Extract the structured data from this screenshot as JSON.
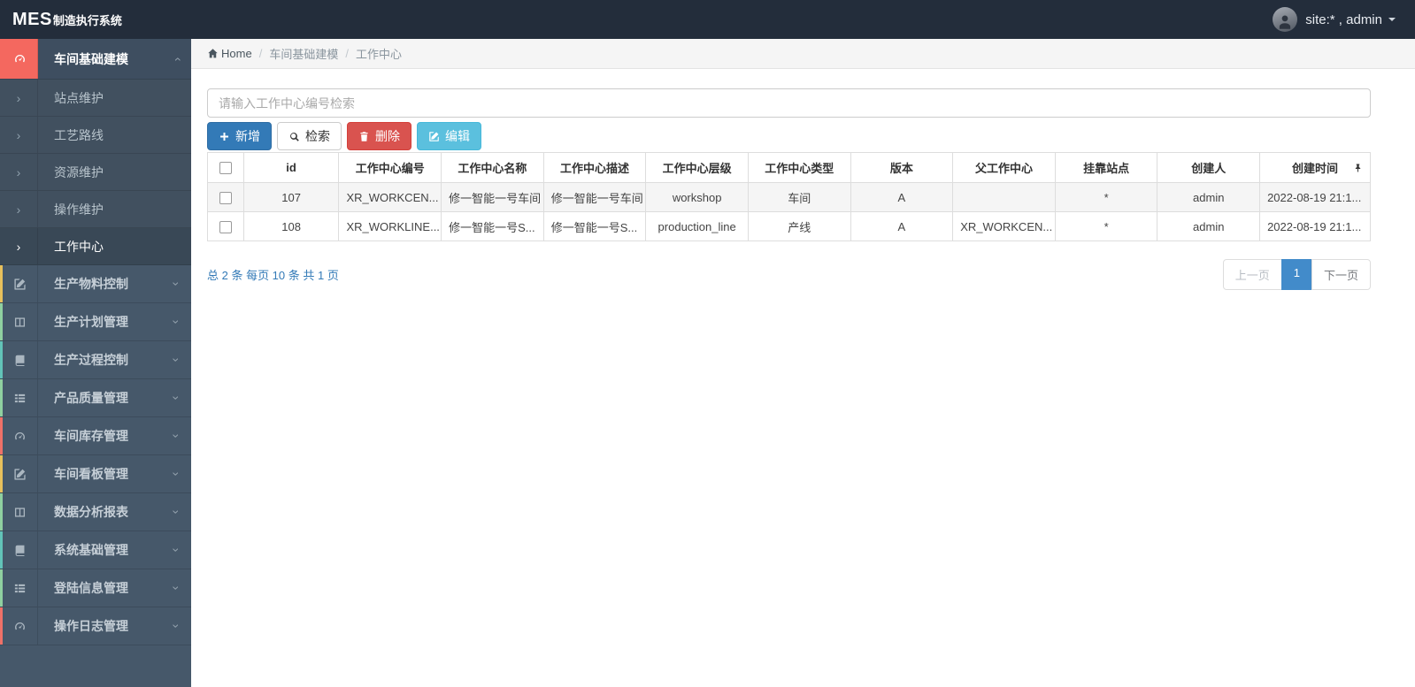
{
  "app": {
    "brand_bold": "MES",
    "brand_rest": "制造执行系统",
    "user": "site:* , admin"
  },
  "theme": {
    "header_bg": "#232d3b",
    "sidebar_bg": "#46586a",
    "active_icon_bg": "#f4685f",
    "strip_yellow": "#e7c05c",
    "strip_green": "#8fd0a0",
    "strip_teal": "#62c3b8",
    "strip_red": "#ef7168",
    "primary_blue": "#337ab7",
    "danger_red": "#d9534f",
    "info_blue": "#5bc0de",
    "active_page_blue": "#428bca"
  },
  "breadcrumb": {
    "home": "Home",
    "sep": "/",
    "items": [
      "车间基础建模",
      "工作中心"
    ]
  },
  "sidebar": {
    "items": [
      {
        "label": "车间基础建模",
        "icon": "tachometer-icon",
        "state": "expanded"
      },
      {
        "label": "生产物料控制",
        "icon": "pencil-square-icon",
        "strip": "yellow"
      },
      {
        "label": "生产计划管理",
        "icon": "columns-icon",
        "strip": "green"
      },
      {
        "label": "生产过程控制",
        "icon": "book-icon",
        "strip": "teal"
      },
      {
        "label": "产品质量管理",
        "icon": "list-icon",
        "strip": "green"
      },
      {
        "label": "车间库存管理",
        "icon": "tachometer-icon",
        "strip": "red"
      },
      {
        "label": "车间看板管理",
        "icon": "pencil-square-icon",
        "strip": "yellow"
      },
      {
        "label": "数据分析报表",
        "icon": "columns-icon",
        "strip": "green"
      },
      {
        "label": "系统基础管理",
        "icon": "book-icon",
        "strip": "teal"
      },
      {
        "label": "登陆信息管理",
        "icon": "list-icon",
        "strip": "green"
      },
      {
        "label": "操作日志管理",
        "icon": "tachometer-icon",
        "strip": "red"
      }
    ],
    "submenu": [
      "站点维护",
      "工艺路线",
      "资源维护",
      "操作维护",
      "工作中心"
    ],
    "active_submenu": "工作中心"
  },
  "toolbar": {
    "add": "新增",
    "search": "检索",
    "delete": "删除",
    "edit": "编辑"
  },
  "search": {
    "placeholder": "请输入工作中心编号检索"
  },
  "table": {
    "headers": [
      "id",
      "工作中心编号",
      "工作中心名称",
      "工作中心描述",
      "工作中心层级",
      "工作中心类型",
      "版本",
      "父工作中心",
      "挂靠站点",
      "创建人",
      "创建时间"
    ],
    "rows": [
      [
        "107",
        "XR_WORKCEN...",
        "修一智能一号车间",
        "修一智能一号车间",
        "workshop",
        "车间",
        "A",
        "",
        "*",
        "admin",
        "2022-08-19 21:1..."
      ],
      [
        "108",
        "XR_WORKLINE...",
        "修一智能一号S...",
        "修一智能一号S...",
        "production_line",
        "产线",
        "A",
        "XR_WORKCEN...",
        "*",
        "admin",
        "2022-08-19 21:1..."
      ]
    ]
  },
  "pagination": {
    "summary": "总 2 条  每页 10 条  共 1 页",
    "prev": "上一页",
    "page": "1",
    "next": "下一页"
  }
}
